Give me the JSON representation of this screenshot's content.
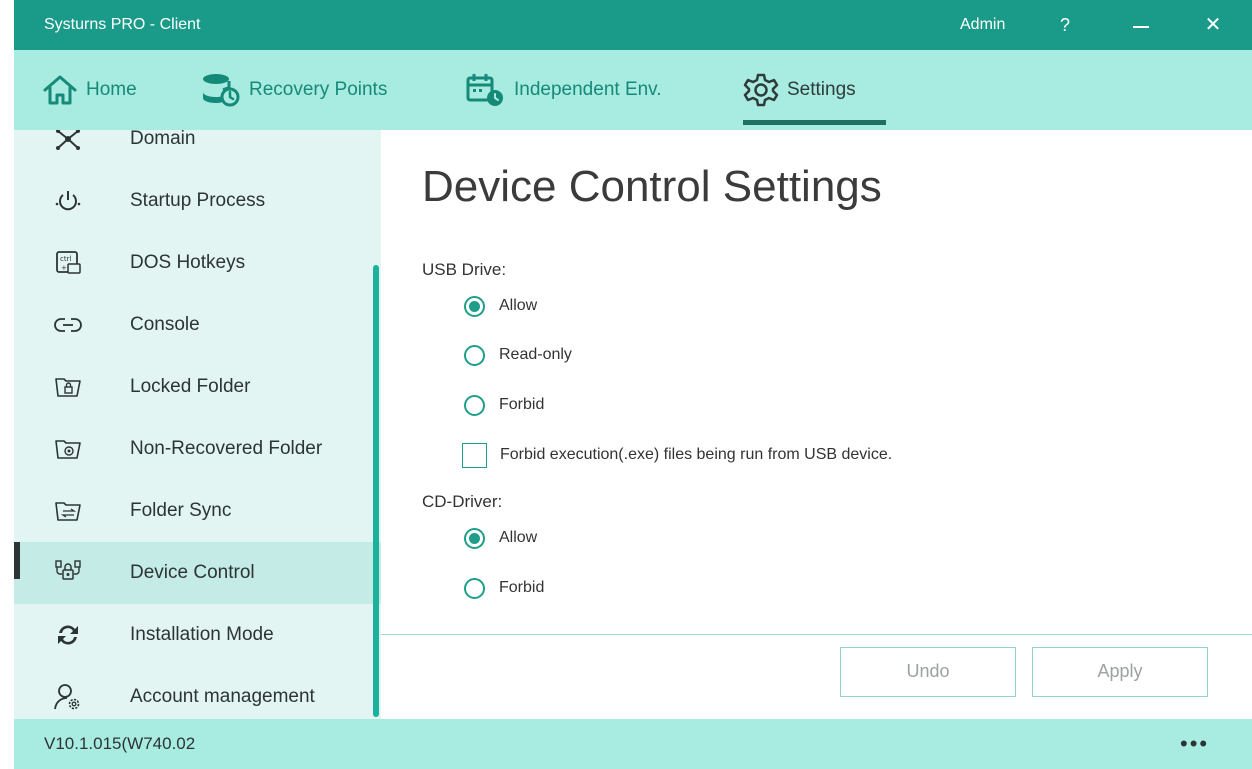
{
  "titlebar": {
    "title": "Systurns PRO - Client",
    "user": "Admin",
    "help": "?",
    "close": "✕"
  },
  "nav": {
    "tabs": [
      {
        "label": "Home",
        "icon": "home-icon"
      },
      {
        "label": "Recovery Points",
        "icon": "database-restore-icon"
      },
      {
        "label": "Independent Env.",
        "icon": "calendar-env-icon"
      },
      {
        "label": "Settings",
        "icon": "gear-icon",
        "active": true
      }
    ]
  },
  "sidebar": {
    "items": [
      {
        "label": "Domain",
        "icon": "network-icon"
      },
      {
        "label": "Startup Process",
        "icon": "power-icon"
      },
      {
        "label": "DOS Hotkeys",
        "icon": "ctrl-key-icon"
      },
      {
        "label": "Console",
        "icon": "link-icon"
      },
      {
        "label": "Locked Folder",
        "icon": "locked-folder-icon"
      },
      {
        "label": "Non-Recovered Folder",
        "icon": "non-recovered-folder-icon"
      },
      {
        "label": "Folder Sync",
        "icon": "folder-sync-icon"
      },
      {
        "label": "Device Control",
        "icon": "device-control-icon",
        "active": true
      },
      {
        "label": "Installation Mode",
        "icon": "refresh-arrows-icon"
      },
      {
        "label": "Account management",
        "icon": "user-gear-icon"
      }
    ]
  },
  "content": {
    "title": "Device Control Settings",
    "usb": {
      "label": "USB Drive:",
      "options": [
        "Allow",
        "Read-only",
        "Forbid"
      ],
      "selected": "Allow",
      "exe_checkbox": {
        "label": "Forbid execution(.exe) files being run from USB device.",
        "checked": false
      }
    },
    "cd": {
      "label": "CD-Driver:",
      "options": [
        "Allow",
        "Forbid"
      ],
      "selected": "Allow"
    },
    "buttons": {
      "undo": "Undo",
      "apply": "Apply"
    }
  },
  "statusbar": {
    "version": "V10.1.015(W740.02",
    "more": "•••"
  },
  "colors": {
    "titlebar": "#1a9a88",
    "navbar": "#a8ebe0",
    "sidebar": "#e2f5f2",
    "accent": "#1f9e8a"
  }
}
